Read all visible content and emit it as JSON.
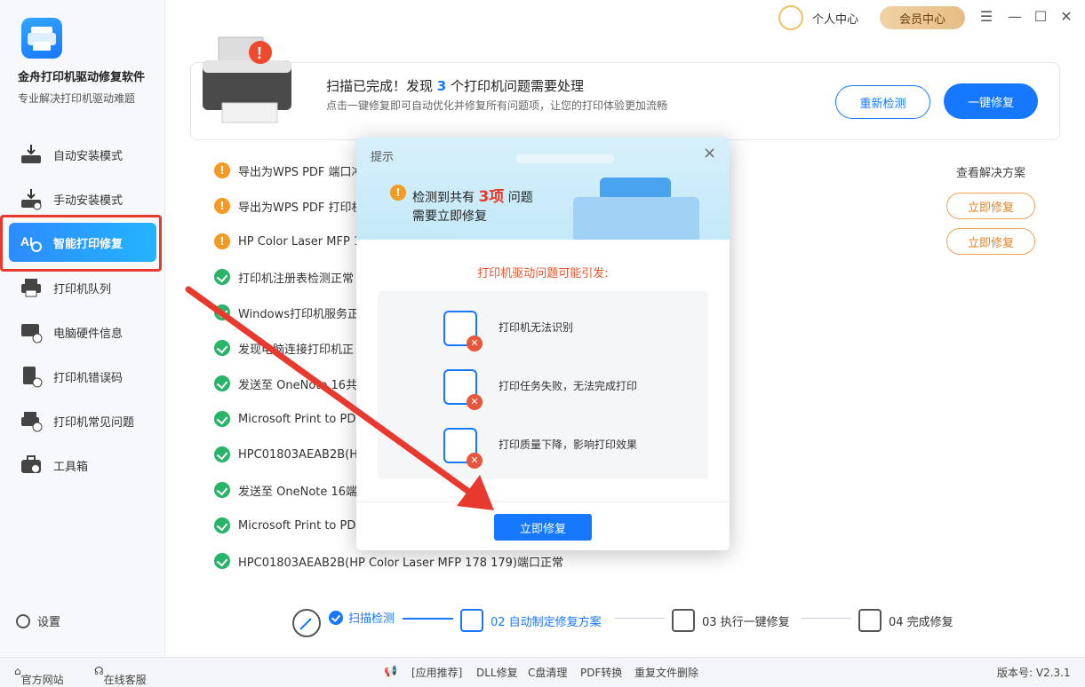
{
  "app": {
    "title": "金舟打印机驱动修复软件",
    "subtitle": "专业解决打印机驱动难题"
  },
  "sidebar": {
    "items": [
      {
        "label": "自动安装模式",
        "icon": "download-install-icon"
      },
      {
        "label": "手动安装模式",
        "icon": "manual-install-icon"
      },
      {
        "label": "智能打印修复",
        "icon": "ai-repair-icon"
      },
      {
        "label": "打印机队列",
        "icon": "printer-queue-icon"
      },
      {
        "label": "电脑硬件信息",
        "icon": "hardware-info-icon"
      },
      {
        "label": "打印机错误码",
        "icon": "error-code-icon"
      },
      {
        "label": "打印机常见问题",
        "icon": "faq-icon"
      },
      {
        "label": "工具箱",
        "icon": "toolbox-icon"
      }
    ],
    "active_index": 2,
    "settings_label": "设置"
  },
  "topbar": {
    "user_label": "个人中心",
    "vip_label": "会员中心",
    "window_menu": "☰",
    "window_min": "—",
    "window_max": "☐",
    "window_close": "✕"
  },
  "scan_card": {
    "title_pre": "扫描已完成！发现",
    "count": "3",
    "title_post": "个打印机问题需要处理",
    "subtitle": "点击一键修复即可自动优化并修复所有问题项，让您的打印体验更加流畅",
    "recheck_label": "重新检测",
    "fix_all_label": "一键修复"
  },
  "issues": {
    "header_right": "查看解决方案",
    "fix_label": "立即修复",
    "rows": [
      {
        "status": "warn",
        "text": "导出为WPS PDF 端口冲"
      },
      {
        "status": "warn",
        "text": "导出为WPS PDF 打印机"
      },
      {
        "status": "warn",
        "text": "HP Color Laser MFP 1"
      },
      {
        "status": "ok",
        "text": "打印机注册表检测正常"
      },
      {
        "status": "ok",
        "text": "Windows打印机服务正"
      },
      {
        "status": "ok",
        "text": "发现电脑连接打印机正"
      },
      {
        "status": "ok",
        "text": "发送至 OneNote 16共"
      },
      {
        "status": "ok",
        "text": "Microsoft Print to PDF"
      },
      {
        "status": "ok",
        "text": "HPC01803AEAB2B(HP"
      },
      {
        "status": "ok",
        "text": "发送至 OneNote 16端"
      },
      {
        "status": "ok",
        "text": "Microsoft Print to PDF"
      },
      {
        "status": "ok",
        "text": "HPC01803AEAB2B(HP Color Laser MFP 178 179)端口正常"
      }
    ]
  },
  "steps": [
    {
      "label": "扫描检测",
      "state": "done"
    },
    {
      "label": "02 自动制定修复方案",
      "state": "active"
    },
    {
      "label": "03 执行一键修复",
      "state": "todo"
    },
    {
      "label": "04 完成修复",
      "state": "todo"
    }
  ],
  "dialog": {
    "header_label": "提示",
    "close": "×",
    "line1_pre": "检测到共有",
    "line1_count": "3项",
    "line1_post": "问题",
    "line2": "需要立即修复",
    "red_title": "打印机驱动问题可能引发:",
    "items": [
      {
        "label": "打印机无法识别",
        "icon": "printer-error-icon"
      },
      {
        "label": "打印任务失败，无法完成打印",
        "icon": "document-error-icon"
      },
      {
        "label": "打印质量下降，影响打印效果",
        "icon": "quality-error-icon"
      }
    ],
    "button_label": "立即修复"
  },
  "footer": {
    "website": "官方网站",
    "service": "在线客服",
    "recommend": "[应用推荐]",
    "link1": "DLL修复",
    "link2": "C盘清理",
    "link3": "PDF转换",
    "link4": "重复文件删除",
    "version": "版本号: V2.3.1"
  },
  "colors": {
    "accent": "#1677ff",
    "warning": "#f59a23",
    "success": "#27b56a",
    "danger": "#e8392e"
  }
}
